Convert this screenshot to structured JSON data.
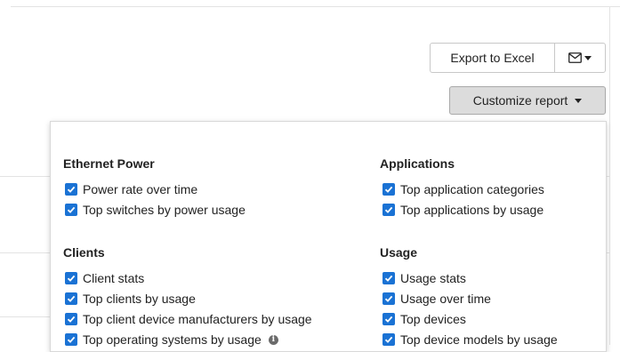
{
  "toolbar": {
    "export_label": "Export to Excel",
    "email_icon": "envelope-icon",
    "customize_label": "Customize report"
  },
  "panel": {
    "sections": [
      {
        "title": "Ethernet Power",
        "items": [
          {
            "label": "Power rate over time",
            "checked": true
          },
          {
            "label": "Top switches by power usage",
            "checked": true
          }
        ]
      },
      {
        "title": "Clients",
        "items": [
          {
            "label": "Client stats",
            "checked": true
          },
          {
            "label": "Top clients by usage",
            "checked": true
          },
          {
            "label": "Top client device manufacturers by usage",
            "checked": true
          },
          {
            "label": "Top operating systems by usage",
            "checked": true
          }
        ]
      },
      {
        "title": "Applications",
        "items": [
          {
            "label": "Top application categories",
            "checked": true
          },
          {
            "label": "Top applications by usage",
            "checked": true
          }
        ]
      },
      {
        "title": "Usage",
        "items": [
          {
            "label": "Usage stats",
            "checked": true
          },
          {
            "label": "Usage over time",
            "checked": true
          },
          {
            "label": "Top devices",
            "checked": true
          },
          {
            "label": "Top device models by usage",
            "checked": true
          }
        ]
      }
    ]
  },
  "colors": {
    "checkbox": "#1a72d4",
    "customize_bg": "#dcdcdc"
  }
}
